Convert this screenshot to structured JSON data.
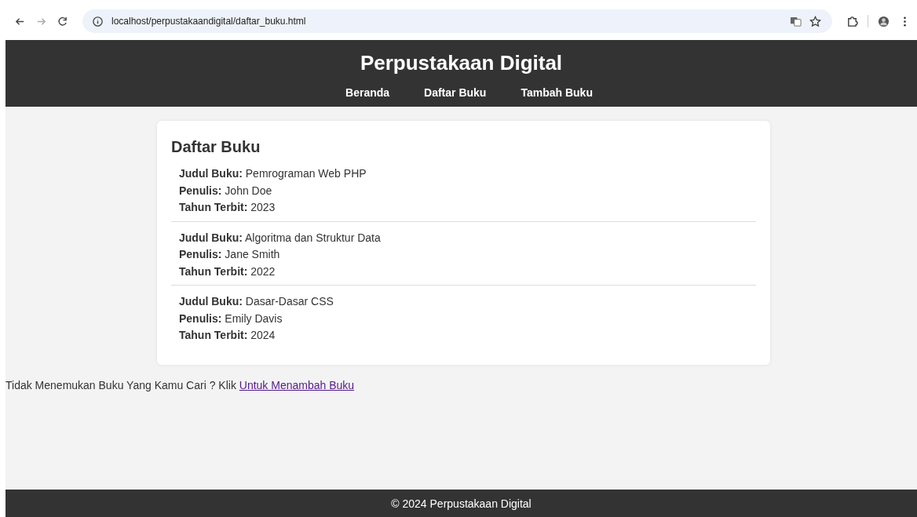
{
  "browser": {
    "url": "localhost/perpustakaandigital/daftar_buku.html"
  },
  "header": {
    "title": "Perpustakaan Digital",
    "nav": [
      {
        "label": "Beranda"
      },
      {
        "label": "Daftar Buku"
      },
      {
        "label": "Tambah Buku"
      }
    ]
  },
  "list": {
    "heading": "Daftar Buku",
    "books": [
      {
        "fields": [
          {
            "label": "Judul Buku:",
            "value": "Pemrograman Web PHP"
          },
          {
            "label": "Penulis:",
            "value": "John Doe"
          },
          {
            "label": "Tahun Terbit:",
            "value": "2023"
          }
        ]
      },
      {
        "fields": [
          {
            "label": "Judul Buku:",
            "value": "Algoritma dan Struktur Data"
          },
          {
            "label": "Penulis:",
            "value": "Jane Smith"
          },
          {
            "label": "Tahun Terbit:",
            "value": "2022"
          }
        ]
      },
      {
        "fields": [
          {
            "label": "Judul Buku:",
            "value": "Dasar-Dasar CSS"
          },
          {
            "label": "Penulis:",
            "value": "Emily Davis"
          },
          {
            "label": "Tahun Terbit:",
            "value": "2024"
          }
        ]
      }
    ]
  },
  "prompt": {
    "text": "Tidak Menemukan Buku Yang Kamu Cari ? Klik",
    "link": "Untuk Menambah Buku"
  },
  "footer": {
    "text": "© 2024 Perpustakaan Digital"
  }
}
